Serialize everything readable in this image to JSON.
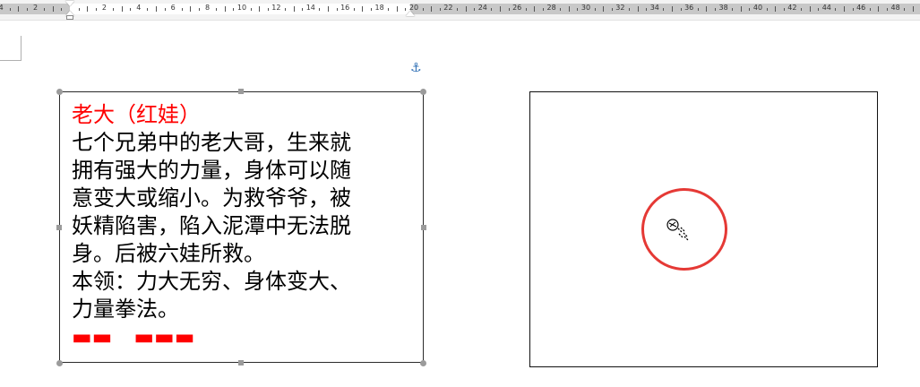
{
  "ruler": {
    "numbers": [
      "4",
      "2",
      "2",
      "4",
      "6",
      "8",
      "10",
      "12",
      "14",
      "16",
      "18",
      "20",
      "22",
      "24",
      "26",
      "28",
      "30",
      "32",
      "34",
      "36",
      "38",
      "40",
      "42",
      "44",
      "46",
      "48"
    ]
  },
  "textbox": {
    "title": "老大（红娃）",
    "lines": [
      "七个兄弟中的老大哥，生来就",
      "拥有强大的力量，身体可以随",
      "意变大或缩小。为救爷爷，被",
      "妖精陷害，陷入泥潭中无法脱",
      "身。后被六娃所救。",
      "本领：力大无穷、身体变大、",
      "力量拳法。"
    ]
  },
  "colors": {
    "title_red": "#ff0000",
    "circle_red": "#e53935",
    "anchor_blue": "#2e6fb5"
  },
  "icons": {
    "anchor": "anchor-icon",
    "cursor": "drag-cursor-icon"
  }
}
